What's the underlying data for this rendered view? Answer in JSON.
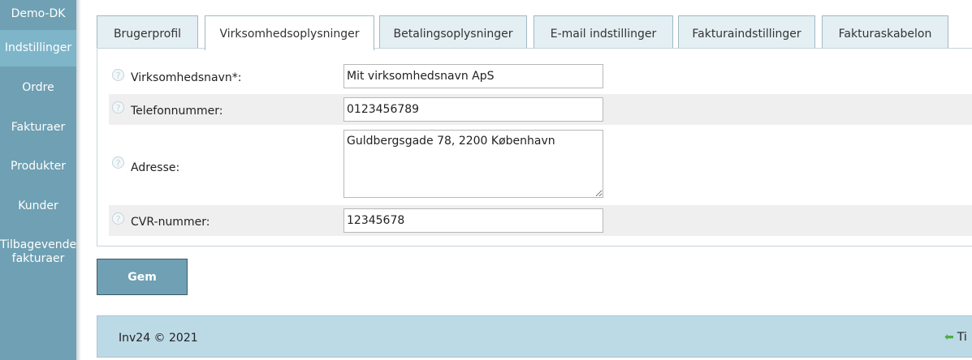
{
  "sidebar": {
    "brand": "Demo-DK",
    "items": [
      {
        "label": "Indstillinger",
        "active": true
      },
      {
        "label": "Ordre"
      },
      {
        "label": "Fakturaer"
      },
      {
        "label": "Produkter"
      },
      {
        "label": "Kunder"
      },
      {
        "label_line1": "Tilbagevender",
        "label_line2": "fakturaer"
      }
    ]
  },
  "tabs": [
    {
      "label": "Brugerprofil"
    },
    {
      "label": "Virksomhedsoplysninger",
      "active": true
    },
    {
      "label": "Betalingsoplysninger"
    },
    {
      "label": "E-mail indstillinger"
    },
    {
      "label": "Fakturaindstillinger"
    },
    {
      "label": "Fakturaskabelon"
    }
  ],
  "form": {
    "company_name": {
      "label": "Virksomhedsnavn*:",
      "value": "Mit virksomhedsnavn ApS"
    },
    "phone": {
      "label": "Telefonnummer:",
      "value": "0123456789"
    },
    "address": {
      "label": "Adresse:",
      "value": "Guldbergsgade 78, 2200 København"
    },
    "cvr": {
      "label": "CVR-nummer:",
      "value": "12345678"
    },
    "help_glyph": "?"
  },
  "buttons": {
    "save_label": "Gem"
  },
  "footer": {
    "text": "Inv24 © 2021",
    "link_text": "Ti",
    "arrow": "⬅"
  },
  "colors": {
    "sidebar": "#6fa0b3",
    "sidebar_active": "#7eb5c9",
    "footer": "#bcd9e6",
    "tab_inactive": "#e4eff3"
  }
}
